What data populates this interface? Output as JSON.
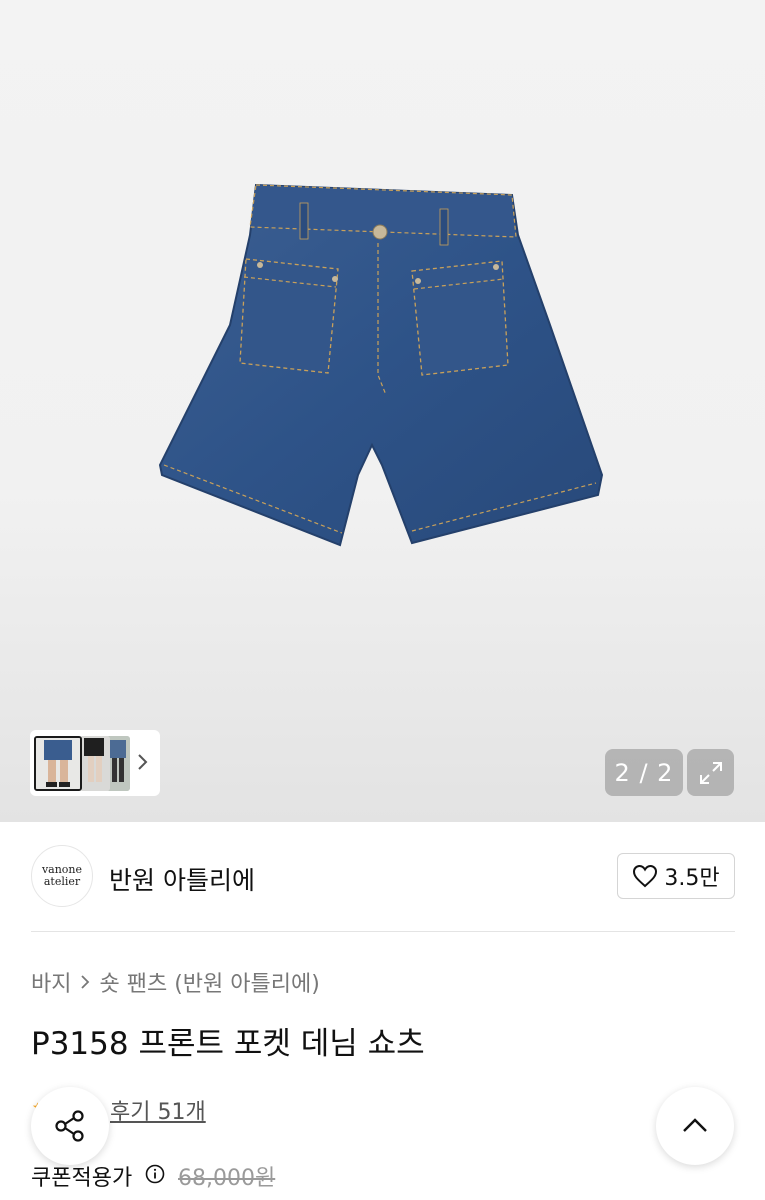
{
  "gallery": {
    "counter": "2 / 2",
    "image_subject": "denim-shorts"
  },
  "brand": {
    "logo_line1": "vanone",
    "logo_line2": "atelier",
    "name": "반원 아틀리에",
    "likes": "3.5만"
  },
  "breadcrumb": {
    "level1": "바지",
    "level2": "숏 팬츠 (반원 아틀리에)"
  },
  "product": {
    "title": "P3158 프론트 포켓 데님 쇼츠",
    "reviews": "후기 51개",
    "price_label": "쿠폰적용가",
    "original_price": "68,000원"
  },
  "colors": {
    "denim": "#2f4f7d",
    "accent_star": "#f5a623"
  }
}
